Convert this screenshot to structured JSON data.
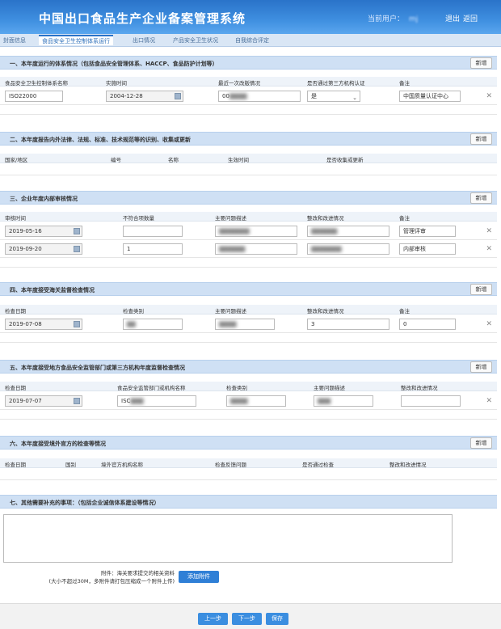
{
  "header": {
    "title": "中国出口食品生产企业备案管理系统",
    "user_label": "当前用户：",
    "user_value": "mj",
    "logout": "退出",
    "back": "返回"
  },
  "tabs": [
    "封面信息",
    "食品安全卫生控制体系运行",
    "出口情况",
    "产品安全卫生状况",
    "自我综合评定"
  ],
  "add_label": "新增",
  "sections": {
    "s1": {
      "title": "一、本年度运行的体系情况（包括食品安全管理体系、HACCP、食品防护计划等）",
      "columns": [
        "食品安全卫生控制体系名称",
        "实施时间",
        "最近一次改版情况",
        "是否通过第三方机构认证",
        "备注"
      ],
      "row": {
        "name": "ISO22000",
        "date": "2004-12-28",
        "revision": "00",
        "certified": "是",
        "remark": "中国质量认证中心"
      }
    },
    "s2": {
      "title": "二、本年度报告内外法律、法规、标准、技术规范等的识别、收集或更新",
      "columns": [
        "国家/地区",
        "编号",
        "名称",
        "生效时间",
        "是否收集或更新"
      ]
    },
    "s3": {
      "title": "三、企业年度内部审核情况",
      "columns": [
        "审核时间",
        "不符合项数量",
        "主要问题描述",
        "整改和改进情况",
        "备注"
      ],
      "rows": [
        {
          "date": "2019-05-16",
          "count": "",
          "remark": "管理评审"
        },
        {
          "date": "2019-09-20",
          "count": "1",
          "remark": "内部审核"
        }
      ]
    },
    "s4": {
      "title": "四、本年度接受海关监督检查情况",
      "columns": [
        "检查日期",
        "检查类别",
        "主要问题描述",
        "整改和改进情况",
        "备注"
      ],
      "row": {
        "date": "2019-07-08",
        "improve": "3",
        "remark": "0"
      }
    },
    "s5": {
      "title": "五、本年度接受地方食品安全监管部门或第三方机构年度监督检查情况",
      "columns": [
        "检查日期",
        "食品安全监管部门或机构名称",
        "检查类别",
        "主要问题描述",
        "整改和改进情况"
      ],
      "row": {
        "date": "2019-07-07",
        "org": "ISC"
      }
    },
    "s6": {
      "title": "六、本年度接受境外官方的检查等情况",
      "columns": [
        "检查日期",
        "国别",
        "境外官方机构名称",
        "检查反馈问题",
        "是否通过检查",
        "整改和改进情况"
      ]
    },
    "s7": {
      "title": "七、其他需要补充的事项：（包括企业诚信体系建设等情况）"
    }
  },
  "attachment": {
    "line1": "附件：海关要求提交的相关资料",
    "line2": "(大小不超过30M，多附件请打包压缩成一个附件上传)",
    "button": "添加附件"
  },
  "footer": {
    "prev": "上一步",
    "next": "下一步",
    "save": "保存"
  }
}
